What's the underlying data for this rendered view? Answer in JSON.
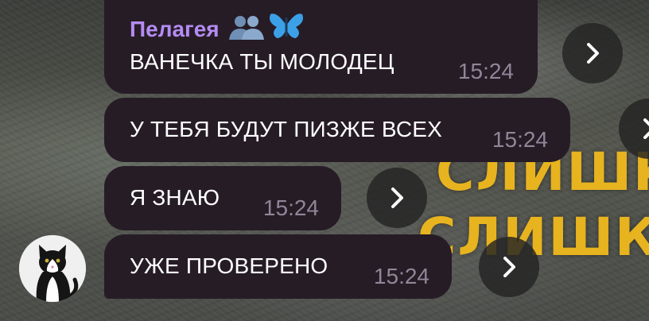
{
  "background": {
    "word_line_1": "СЛИШК",
    "word_line_2": "СЛИШКС",
    "text_color": "#e7b31f"
  },
  "chat": {
    "sender_name": "Пелагея",
    "sender_color": "#b48cf2",
    "sender_emojis": [
      "people-hugging-emoji",
      "butterfly-emoji"
    ],
    "messages": [
      {
        "text": "ВАНЕЧКА ТЫ МОЛОДЕЦ",
        "time": "15:24"
      },
      {
        "text": "У ТЕБЯ БУДУТ ПИЗЖЕ ВСЕХ",
        "time": "15:24"
      },
      {
        "text": "Я ЗНАЮ",
        "time": "15:24"
      },
      {
        "text": "УЖЕ ПРОВЕРЕНО",
        "time": "15:24"
      }
    ],
    "bubble_color": "#261c26",
    "forward_icon": "chevron-right-icon",
    "avatar": "cat-avatar"
  }
}
